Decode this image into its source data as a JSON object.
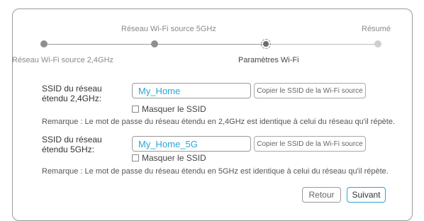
{
  "stepper": {
    "steps": [
      {
        "label": "Réseau Wi-Fi source 2,4GHz",
        "state": "done"
      },
      {
        "label": "Réseau Wi-Fi source 5GHz",
        "state": "done"
      },
      {
        "label": "Paramètres Wi-Fi",
        "state": "current"
      },
      {
        "label": "Résumé",
        "state": "pending"
      }
    ]
  },
  "ssid24": {
    "label": "SSID du réseau étendu 2,4GHz:",
    "value": "My_Home",
    "copy_label": "Copier le SSID de la Wi-Fi source",
    "hide_label": "Masquer le SSID",
    "hide_checked": false,
    "remark": "Remarque : Le mot de passe du réseau étendu en 2,4GHz est identique à celui du réseau qu'il répète."
  },
  "ssid5": {
    "label": "SSID du réseau étendu 5GHz:",
    "value": "My_Home_5G",
    "copy_label": "Copier le SSID de la Wi-Fi source",
    "hide_label": "Masquer le SSID",
    "hide_checked": false,
    "remark": "Remarque : Le mot de passe du réseau étendu en 5GHz est identique à celui du réseau qu'il répète."
  },
  "footer": {
    "back_label": "Retour",
    "next_label": "Suivant"
  },
  "colors": {
    "accent": "#2aa6d6",
    "border": "#9a9a9a"
  }
}
